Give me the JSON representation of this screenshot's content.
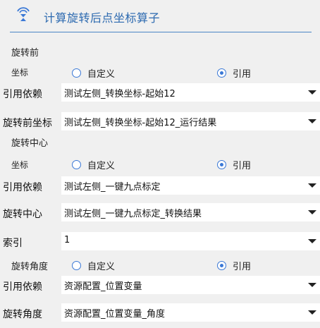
{
  "header": {
    "title": "计算旋转后点坐标算子",
    "icon": "operator-icon",
    "accent_color": "#2d6ab0"
  },
  "sections": {
    "before": "旋转前",
    "center": "旋转中心",
    "angle": "旋转角度"
  },
  "labels": {
    "coord": "坐标",
    "custom": "自定义",
    "reference": "引用",
    "ref_dep": "引用依赖",
    "before_coord": "旋转前坐标",
    "center_field": "旋转中心",
    "index": "索引",
    "angle_field": "旋转角度"
  },
  "before": {
    "mode": "引用",
    "ref_dep_value": "测试左侧_转换坐标-起始12",
    "coord_value": "测试左侧_转换坐标-起始12_运行结果"
  },
  "center": {
    "mode": "引用",
    "ref_dep_value": "测试左侧_一键九点标定",
    "center_value": "测试左侧_一键九点标定_转换结果",
    "index_value": "1"
  },
  "angle": {
    "mode": "引用",
    "ref_dep_value": "资源配置_位置变量",
    "angle_value": "资源配置_位置变量_角度"
  }
}
